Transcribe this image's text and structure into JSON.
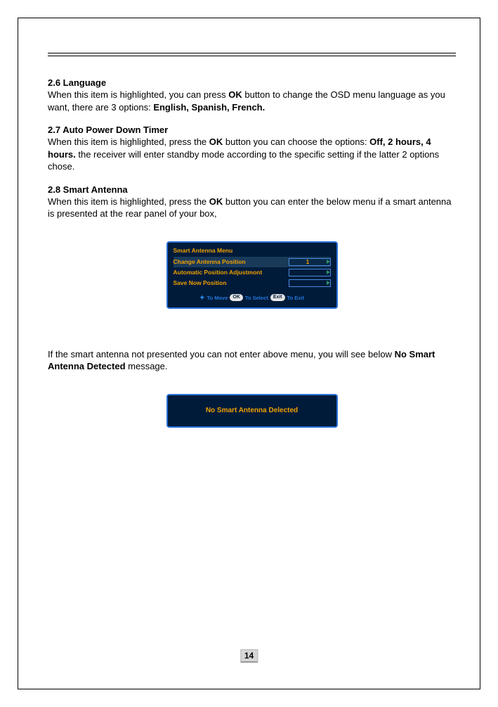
{
  "sections": {
    "s26": {
      "title": "2.6 Language",
      "text_a": "When this item is highlighted, you can press ",
      "ok": "OK",
      "text_b": " button to change the OSD menu language as you want, there are 3 options: ",
      "opts": "English, Spanish, French."
    },
    "s27": {
      "title": "2.7 Auto Power Down Timer",
      "text_a": "When this item is highlighted, press the ",
      "ok": "OK",
      "text_b": " button you can choose the options: ",
      "opts": "Off, 2 hours, 4 hours.",
      "text_c": " the receiver will enter standby mode  according to the specific setting if the latter 2 options chose."
    },
    "s28": {
      "title": "2.8 Smart Antenna",
      "text_a": "When this item is highlighted, press the ",
      "ok": "OK",
      "text_b": " button you can enter the below menu if a smart antenna is presented at the rear panel of your box,"
    }
  },
  "osd": {
    "title": "Smart Antenna Menu",
    "row1_label": "Change Antenna Position",
    "row1_value": "1",
    "row2_label": "Automatic Position Adjustmont",
    "row3_label": "Save Now Position",
    "footer_move": "To Move",
    "footer_ok": "OK",
    "footer_select": "To Select",
    "footer_exit": "Exit",
    "footer_toexit": "To Exit"
  },
  "mid": {
    "text_a": "If the smart antenna not presented you can not enter above menu, you will see below ",
    "bold": "No Smart Antenna Detected",
    "text_b": " message."
  },
  "no_detect": "No Smart Antenna Delected",
  "page_number": "14"
}
